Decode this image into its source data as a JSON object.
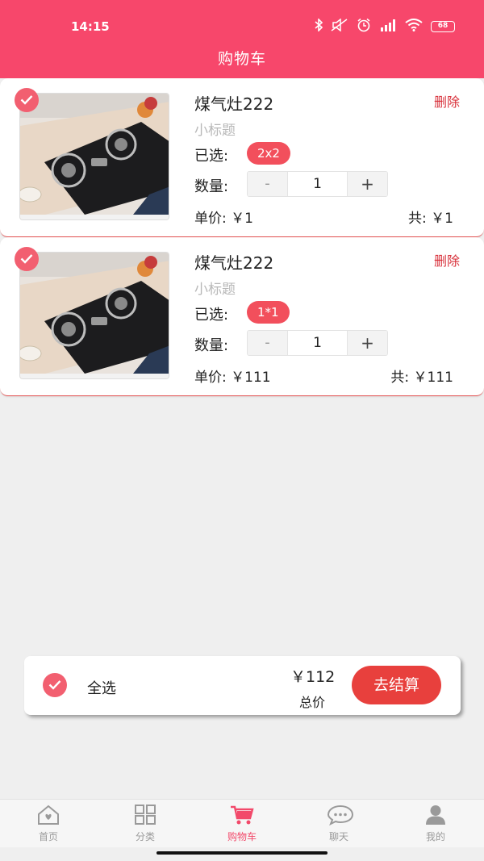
{
  "status_bar": {
    "time": "14:15",
    "battery": "68"
  },
  "header": {
    "title": "购物车"
  },
  "cart_items": [
    {
      "title": "煤气灶222",
      "subtitle": "小标题",
      "selected_label": "已选:",
      "selected_spec": "2x2",
      "quantity_label": "数量:",
      "quantity": "1",
      "minus": "-",
      "plus": "+",
      "unit_price": "单价: ￥1",
      "total": "共: ￥1",
      "delete": "删除",
      "checked": true
    },
    {
      "title": "煤气灶222",
      "subtitle": "小标题",
      "selected_label": "已选:",
      "selected_spec": "1*1",
      "quantity_label": "数量:",
      "quantity": "1",
      "minus": "-",
      "plus": "+",
      "unit_price": "单价: ￥111",
      "total": "共: ￥111",
      "delete": "删除",
      "checked": true
    }
  ],
  "summary": {
    "select_all": "全选",
    "amount": "￥112",
    "amount_label": "总价",
    "checkout": "去结算"
  },
  "tabbar": [
    {
      "label": "首页",
      "icon": "home-icon",
      "active": false
    },
    {
      "label": "分类",
      "icon": "category-grid-icon",
      "active": false
    },
    {
      "label": "购物车",
      "icon": "cart-icon",
      "active": true
    },
    {
      "label": "聊天",
      "icon": "chat-icon",
      "active": false
    },
    {
      "label": "我的",
      "icon": "user-icon",
      "active": false
    }
  ],
  "colors": {
    "brand": "#f7476b",
    "accent": "#e8403d",
    "tag": "#f24f5c"
  }
}
